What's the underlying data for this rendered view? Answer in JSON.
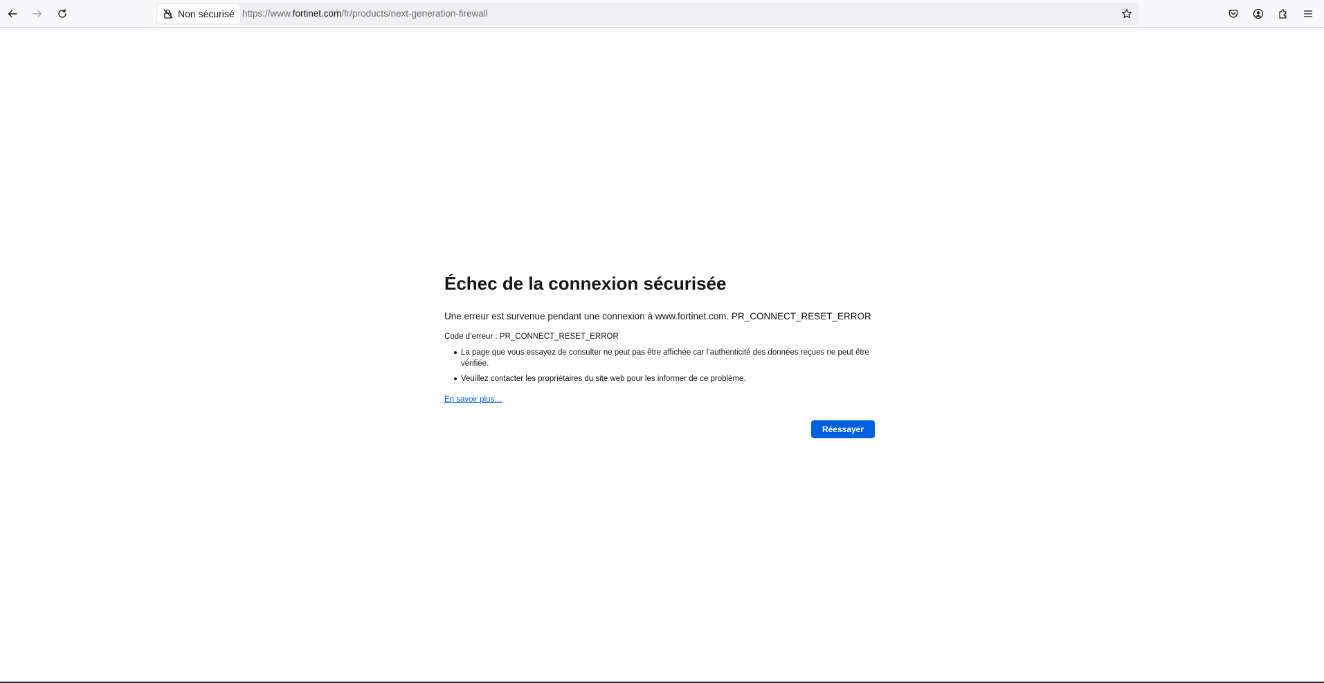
{
  "browser": {
    "security_label": "Non sécurisé",
    "url_prefix": "https://www.",
    "url_host": "fortinet.com",
    "url_path": "/fr/products/next-generation-firewall",
    "icons": {
      "back": "back-arrow-icon",
      "forward": "forward-arrow-icon",
      "reload": "reload-icon",
      "security": "insecure-lock-icon",
      "bookmark": "star-icon",
      "pocket": "pocket-icon",
      "account": "account-icon",
      "extensions": "extensions-icon",
      "menu": "hamburger-menu-icon"
    }
  },
  "error_page": {
    "title": "Échec de la connexion sécurisée",
    "description": "Une erreur est survenue pendant une connexion à www.fortinet.com. PR_CONNECT_RESET_ERROR",
    "code_line": "Code d’erreur : PR_CONNECT_RESET_ERROR",
    "bullets": [
      "La page que vous essayez de consulter ne peut pas être affichée car l’authenticité des données reçues ne peut être vérifiée.",
      "Veuillez contacter les propriétaires du site web pour les informer de ce problème."
    ],
    "learn_more": "En savoir plus…",
    "retry_button": "Réessayer"
  },
  "colors": {
    "accent": "#0061e0",
    "toolbar_bg": "#f9f9fb",
    "urlbar_bg": "#f0f0f4"
  }
}
